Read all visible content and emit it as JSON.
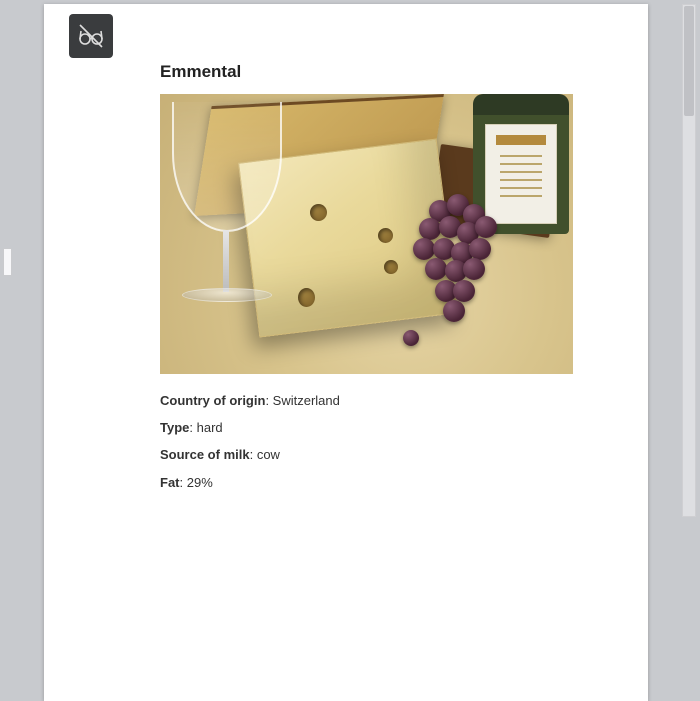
{
  "title": "Emmental",
  "fields": {
    "country": {
      "label": "Country of origin",
      "value": "Switzerland"
    },
    "type": {
      "label": "Type",
      "value": "hard"
    },
    "milk": {
      "label": "Source of milk",
      "value": "cow"
    },
    "fat": {
      "label": "Fat",
      "value": "29%"
    }
  },
  "icons": {
    "reader_toggle": "glasses-off-icon"
  }
}
